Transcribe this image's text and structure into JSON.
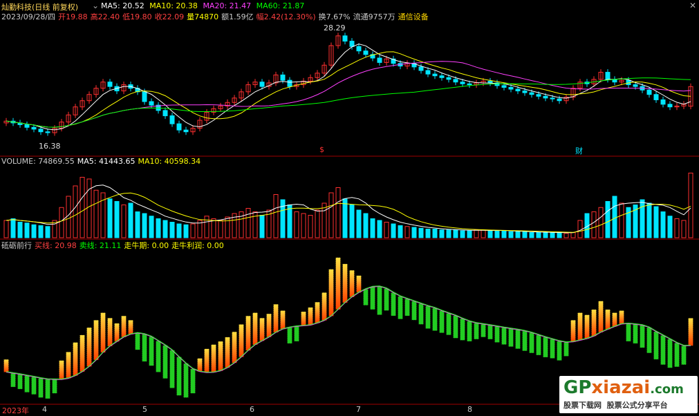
{
  "header": {
    "stock_name": "灿勤科技(日线 前复权)",
    "ma": [
      {
        "label": "MA5: 20.52",
        "color": "#ffffff"
      },
      {
        "label": "MA10: 20.38",
        "color": "#ffff00"
      },
      {
        "label": "MA20: 21.47",
        "color": "#ff40ff"
      },
      {
        "label": "MA60: 21.87",
        "color": "#00ff00"
      }
    ],
    "info_line": [
      {
        "text": "2023/09/28/四",
        "color": "#cccccc"
      },
      {
        "text": "开19.88",
        "color": "#ff4040"
      },
      {
        "text": "高22.40",
        "color": "#ff4040"
      },
      {
        "text": "低19.80",
        "color": "#ff4040"
      },
      {
        "text": "收22.09",
        "color": "#ff4040"
      },
      {
        "text": "量74870",
        "color": "#ffff00"
      },
      {
        "text": "额1.59亿",
        "color": "#cccccc"
      },
      {
        "text": "幅2.42(12.30%)",
        "color": "#ff4040"
      },
      {
        "text": "换7.67%",
        "color": "#cccccc"
      },
      {
        "text": "流通9757万",
        "color": "#cccccc"
      },
      {
        "text": "通信设备",
        "color": "#ffd700"
      }
    ],
    "high_label": "28.29",
    "low_label": "16.38",
    "marker_a": "$",
    "marker_b": "财"
  },
  "volume_header": [
    {
      "text": "VOLUME: 74869.55",
      "color": "#cccccc"
    },
    {
      "text": "MA5: 41443.65",
      "color": "#ffffff"
    },
    {
      "text": "MA10: 40598.34",
      "color": "#ffff00"
    }
  ],
  "indicator_header": [
    {
      "text": "砥砺前行",
      "color": "#cccccc"
    },
    {
      "text": "买线: 20.98",
      "color": "#ff4040"
    },
    {
      "text": "卖线: 21.11",
      "color": "#00ff00"
    },
    {
      "text": "走牛期: 0.00",
      "color": "#ffff00"
    },
    {
      "text": "走牛利润: 0.00",
      "color": "#ffff00"
    }
  ],
  "x_axis": [
    "2023年",
    "4",
    "5",
    "6",
    "7",
    "8"
  ],
  "watermark": {
    "brand_a": "GP",
    "brand_b": "xiazai",
    "brand_c": ".com",
    "sub_a": "股票下载网",
    "sub_b": "股票公式分享平台"
  },
  "colors": {
    "up": "#ff3030",
    "down": "#00e5ff",
    "ma5": "#ffffff",
    "ma10": "#ffff00",
    "ma20": "#ff40ff",
    "ma60": "#00ff00"
  },
  "chart_data": [
    {
      "type": "candlestick",
      "title": "灿勤科技(日线 前复权)",
      "ylim": [
        15.5,
        29.5
      ],
      "close": [
        18.2,
        18.0,
        17.8,
        17.5,
        17.3,
        17.0,
        16.9,
        17.4,
        18.1,
        18.9,
        19.8,
        20.5,
        21.2,
        21.9,
        22.6,
        22.1,
        21.6,
        22.3,
        21.9,
        21.5,
        20.4,
        20.0,
        19.4,
        18.8,
        17.9,
        17.2,
        17.0,
        17.4,
        18.3,
        19.2,
        19.6,
        19.9,
        20.3,
        20.8,
        21.5,
        22.3,
        22.6,
        22.1,
        22.5,
        23.4,
        22.8,
        22.1,
        22.3,
        22.7,
        23.1,
        23.6,
        24.5,
        26.7,
        27.8,
        27.2,
        26.6,
        26.1,
        25.7,
        25.3,
        24.8,
        25.2,
        24.7,
        24.4,
        24.7,
        24.3,
        23.9,
        23.5,
        23.3,
        23.1,
        22.9,
        22.6,
        22.4,
        22.3,
        22.5,
        22.7,
        22.5,
        22.2,
        22.0,
        21.8,
        21.6,
        21.4,
        21.2,
        21.0,
        20.8,
        20.7,
        20.5,
        20.9,
        21.9,
        22.6,
        22.4,
        22.9,
        23.7,
        22.9,
        22.6,
        22.8,
        22.3,
        22.1,
        21.7,
        21.2,
        20.6,
        20.1,
        19.8,
        19.9,
        20.1,
        22.09
      ],
      "open": [
        18.0,
        18.2,
        18.0,
        17.8,
        17.5,
        17.3,
        17.0,
        16.9,
        17.4,
        18.1,
        18.9,
        19.8,
        20.5,
        21.2,
        21.9,
        22.6,
        22.1,
        21.6,
        22.3,
        21.9,
        21.5,
        20.4,
        20.0,
        19.4,
        18.8,
        17.9,
        17.2,
        17.0,
        17.4,
        18.3,
        19.2,
        19.6,
        19.9,
        20.3,
        20.8,
        21.5,
        22.3,
        22.6,
        22.1,
        22.5,
        23.4,
        22.8,
        22.1,
        22.3,
        22.7,
        23.1,
        23.6,
        24.5,
        26.7,
        27.8,
        27.2,
        26.6,
        26.1,
        25.7,
        25.3,
        24.8,
        25.2,
        24.7,
        24.4,
        24.7,
        24.3,
        23.9,
        23.5,
        23.3,
        23.1,
        22.9,
        22.6,
        22.4,
        22.3,
        22.5,
        22.7,
        22.5,
        22.2,
        22.0,
        21.8,
        21.6,
        21.4,
        21.2,
        21.0,
        20.8,
        20.7,
        20.5,
        20.9,
        21.9,
        22.6,
        22.4,
        22.9,
        23.7,
        22.9,
        22.6,
        22.8,
        22.3,
        22.1,
        21.7,
        21.2,
        20.6,
        20.1,
        19.8,
        19.9,
        19.88
      ]
    },
    {
      "type": "bar",
      "title": "VOLUME",
      "values": [
        20,
        22,
        18,
        17,
        15,
        14,
        13,
        20,
        35,
        48,
        60,
        70,
        68,
        55,
        52,
        45,
        42,
        38,
        40,
        30,
        28,
        25,
        22,
        20,
        18,
        16,
        15,
        16,
        20,
        25,
        22,
        20,
        24,
        28,
        30,
        34,
        30,
        26,
        32,
        50,
        44,
        38,
        30,
        28,
        26,
        32,
        40,
        52,
        58,
        45,
        38,
        32,
        28,
        22,
        20,
        18,
        16,
        14,
        13,
        12,
        11,
        10,
        10,
        9,
        9,
        9,
        8,
        8,
        9,
        9,
        8,
        8,
        8,
        7,
        7,
        7,
        6,
        6,
        6,
        6,
        6,
        5,
        6,
        20,
        28,
        30,
        35,
        42,
        48,
        40,
        35,
        38,
        44,
        40,
        36,
        30,
        25,
        22,
        20,
        74.87
      ]
    },
    {
      "type": "bar",
      "title": "砥砺前行",
      "buy_line_last": 20.98,
      "sell_line_last": 21.11
    }
  ]
}
